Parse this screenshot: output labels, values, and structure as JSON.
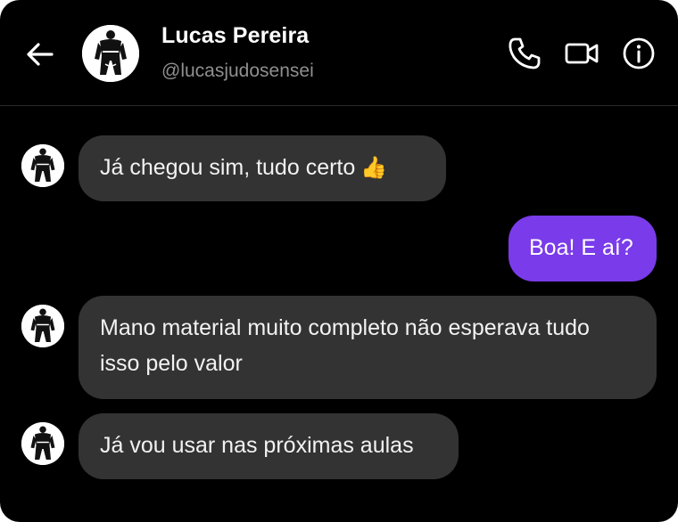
{
  "header": {
    "name": "Lucas Pereira",
    "handle": "@lucasjudosensei"
  },
  "messages": [
    {
      "direction": "incoming",
      "text": "Já chegou sim, tudo certo",
      "emoji": "👍"
    },
    {
      "direction": "outgoing",
      "text": "Boa! E aí?"
    },
    {
      "direction": "incoming",
      "text": "Mano material muito completo não esperava tudo isso pelo valor"
    },
    {
      "direction": "incoming",
      "text": "Já vou usar nas próximas aulas"
    }
  ],
  "colors": {
    "background": "#000000",
    "incoming_bubble": "#333333",
    "outgoing_bubble": "#7a3bea",
    "handle_text": "#8f8f8f"
  },
  "icons": [
    "back-arrow-icon",
    "phone-icon",
    "video-camera-icon",
    "info-icon"
  ]
}
